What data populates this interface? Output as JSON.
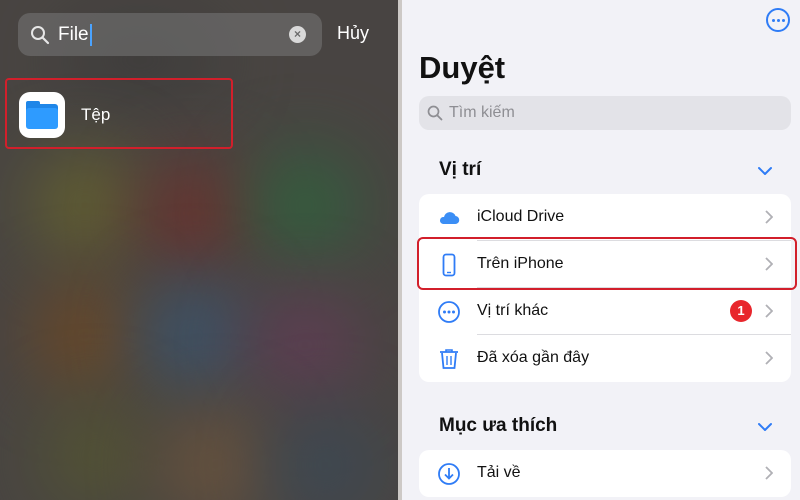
{
  "spotlight": {
    "query": "File",
    "cancel_label": "Hủy",
    "result": {
      "name": "Tệp",
      "icon": "files-app-icon"
    }
  },
  "files": {
    "title": "Duyệt",
    "search_placeholder": "Tìm kiếm",
    "locations": {
      "heading": "Vị trí",
      "items": [
        {
          "label": "iCloud Drive",
          "icon": "icloud-icon"
        },
        {
          "label": "Trên iPhone",
          "icon": "iphone-icon"
        },
        {
          "label": "Vị trí khác",
          "icon": "more-circle-icon",
          "badge": "1"
        },
        {
          "label": "Đã xóa gần đây",
          "icon": "trash-icon"
        }
      ]
    },
    "favorites": {
      "heading": "Mục ưa thích",
      "items": [
        {
          "label": "Tải về",
          "icon": "download-icon"
        }
      ]
    }
  },
  "colors": {
    "accent": "#2f7cf6",
    "highlight": "#d21f2b",
    "badge": "#e8262c",
    "folder": "#2e9bff"
  }
}
